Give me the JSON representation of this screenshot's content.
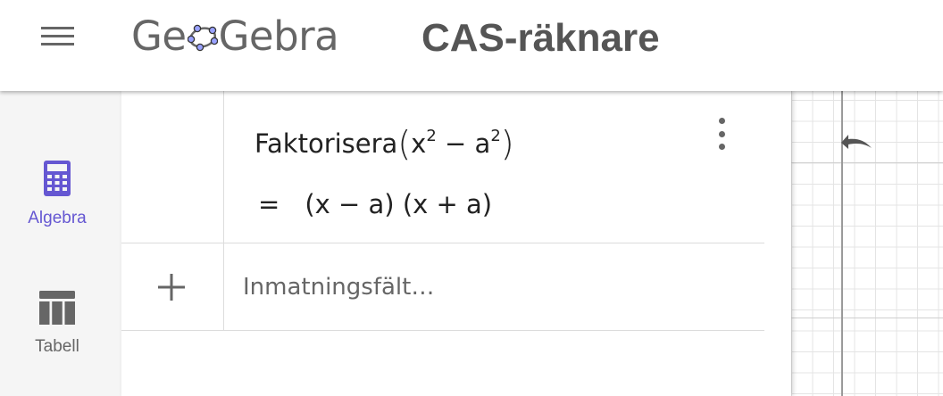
{
  "header": {
    "logo_pre": "Ge",
    "logo_post": "Gebra",
    "app_title": "CAS-räknare"
  },
  "sidebar": {
    "items": [
      {
        "label": "Algebra",
        "icon": "calculator-icon",
        "active": true
      },
      {
        "label": "Tabell",
        "icon": "table-icon",
        "active": false
      }
    ]
  },
  "cas": {
    "rows": [
      {
        "input": {
          "command": "Faktorisera",
          "base1": "x",
          "exp1": "2",
          "op": "−",
          "base2": "a",
          "exp2": "2"
        },
        "output": {
          "eq": "=",
          "factor1": "(x − a)",
          "factor2": "(x + a)"
        }
      }
    ],
    "input_placeholder": "Inmatningsfält…"
  },
  "colors": {
    "accent": "#6557d2",
    "text": "#222222",
    "muted": "#666666"
  }
}
